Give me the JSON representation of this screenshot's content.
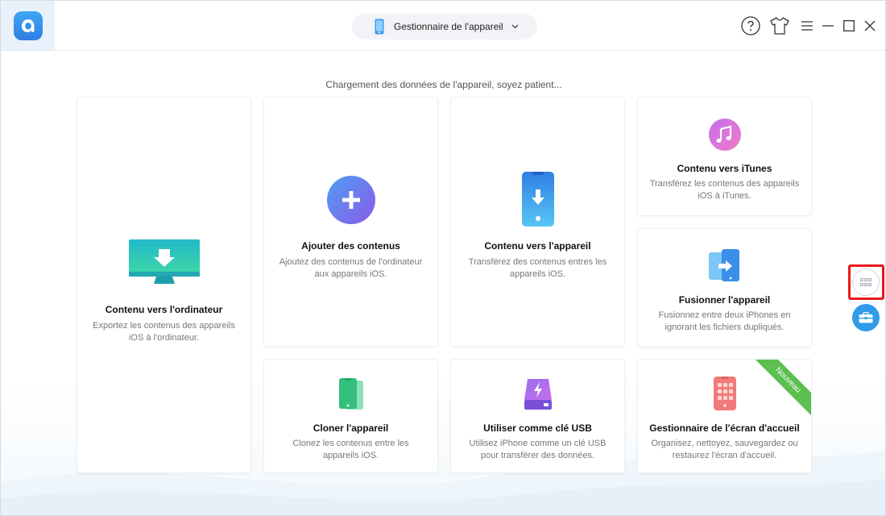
{
  "titlebar": {
    "device_selector": "Gestionnaire de l'appareil"
  },
  "status_text": "Chargement des données de l'appareil, soyez patient...",
  "cards": {
    "to_computer": {
      "title": "Contenu vers l'ordinateur",
      "desc": "Exportez les contenus des appareils iOS à l'ordinateur."
    },
    "add_content": {
      "title": "Ajouter des contenus",
      "desc": "Ajoutez des contenus de l'ordinateur aux appareils iOS."
    },
    "to_device": {
      "title": "Contenu vers l'appareil",
      "desc": "Transférez des contenus entres les appareils iOS."
    },
    "to_itunes": {
      "title": "Contenu vers iTunes",
      "desc": "Transférez les contenus des appareils iOS à iTunes."
    },
    "merge_device": {
      "title": "Fusionner l'appareil",
      "desc": "Fusionnez entre deux iPhones en ignorant les fichiers dupliqués."
    },
    "clone_device": {
      "title": "Cloner l'appareil",
      "desc": "Clonez les contenus entre les appareils iOS."
    },
    "usb_key": {
      "title": "Utiliser comme clé USB",
      "desc": "Utilisez iPhone comme un clé USB pour transférer des données."
    },
    "home_screen": {
      "title": "Gestionnaire de l'écran d'accueil",
      "desc": "Organisez, nettoyez, sauvegardez ou restaurez l'écran d'accueil.",
      "badge": "Nouveau"
    }
  },
  "icons": {
    "logo": "app-logo-icon",
    "help": "help-icon",
    "skin": "tshirt-icon",
    "menu": "menu-icon",
    "minimize": "minimize-icon",
    "maximize": "maximize-icon",
    "close": "close-icon",
    "side_grid": "grid-icon",
    "side_toolbox": "toolbox-icon"
  },
  "colors": {
    "accent_blue": "#2f8fe8",
    "ribbon_green": "#5cbf4f",
    "highlight_red": "#e81a1a"
  }
}
